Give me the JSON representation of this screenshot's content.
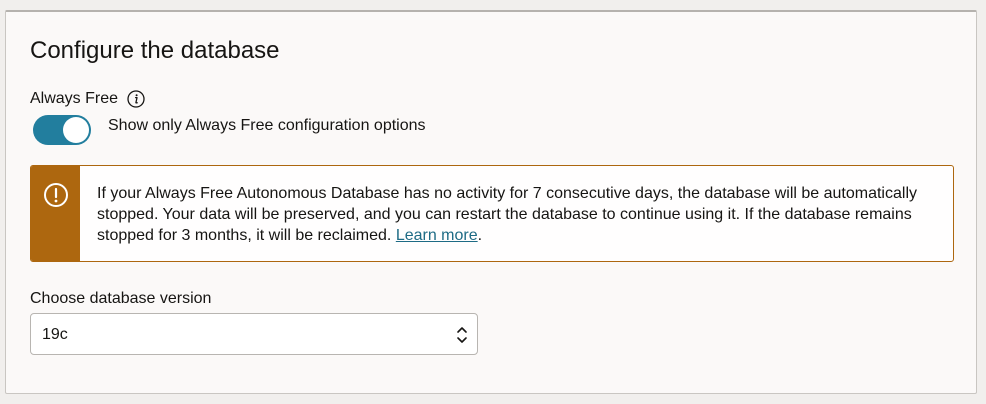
{
  "section": {
    "title": "Configure the database"
  },
  "always_free": {
    "label": "Always Free",
    "info_icon": "info-icon",
    "toggle": {
      "on": true,
      "label": "Show only Always Free configuration options"
    }
  },
  "alert": {
    "icon": "exclamation-circle-icon",
    "text": "If your Always Free Autonomous Database has no activity for 7 consecutive days, the database will be automatically stopped. Your data will be preserved, and you can restart the database to continue using it. If the database remains stopped for 3 months, it will be reclaimed. ",
    "link_text": "Learn more",
    "suffix": ".",
    "accent_color": "#ad670f"
  },
  "database_version": {
    "label": "Choose database version",
    "selected": "19c",
    "icon": "up-down-chevron-icon"
  },
  "colors": {
    "toggle_on": "#227e9e",
    "link": "#1e6b85"
  }
}
